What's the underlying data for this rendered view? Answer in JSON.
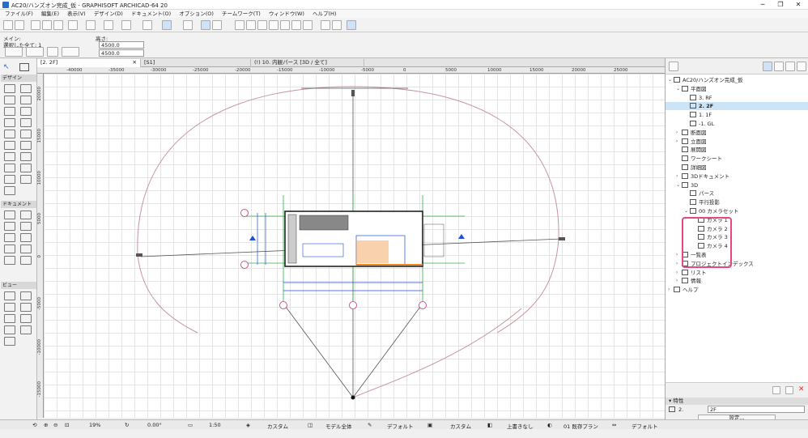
{
  "window": {
    "title": "AC20/ハンズオン完成_仮 - GRAPHISOFT ARCHICAD-64 20"
  },
  "menu": [
    "ファイル(F)",
    "編集(E)",
    "表示(V)",
    "デザイン(D)",
    "ドキュメント(O)",
    "オプション(O)",
    "チームワーク(T)",
    "ウィンドウ(W)",
    "ヘルプ(H)"
  ],
  "infobox": {
    "main_label": "メイン:",
    "selected_label": "選択した全て: 1",
    "height_label": "高さ:",
    "value1": "4500.0",
    "value2": "4500.0"
  },
  "toolbox": {
    "sections": [
      "デザイン",
      "ドキュメント",
      "ビュー"
    ]
  },
  "tabs": [
    "[2. 2F]",
    "[S1]",
    "(!) 10. 内観パース [3D / 全て]"
  ],
  "ruler": {
    "h": [
      "-40000",
      "-35000",
      "-30000",
      "-25000",
      "-20000",
      "-15000",
      "-10000",
      "-5000",
      "0",
      "5000",
      "10000",
      "15000",
      "20000",
      "25000"
    ],
    "v": [
      "20000",
      "15000",
      "10000",
      "5000",
      "0",
      "-5000",
      "-10000",
      "-15000"
    ]
  },
  "navigator": {
    "tree": [
      {
        "label": "AC20/ハンズオン完成_仮",
        "level": 0,
        "arrow": "v"
      },
      {
        "label": "平面図",
        "level": 1,
        "arrow": "v"
      },
      {
        "label": "3. RF",
        "level": 2,
        "arrow": ""
      },
      {
        "label": "2. 2F",
        "level": 2,
        "arrow": "",
        "selected": true
      },
      {
        "label": "1. 1F",
        "level": 2,
        "arrow": ""
      },
      {
        "label": "-1. GL",
        "level": 2,
        "arrow": ""
      },
      {
        "label": "断面図",
        "level": 1,
        "arrow": ">"
      },
      {
        "label": "立面図",
        "level": 1,
        "arrow": ">"
      },
      {
        "label": "展開図",
        "level": 1,
        "arrow": ""
      },
      {
        "label": "ワークシート",
        "level": 1,
        "arrow": ""
      },
      {
        "label": "詳細図",
        "level": 1,
        "arrow": ""
      },
      {
        "label": "3Dドキュメント",
        "level": 1,
        "arrow": ">"
      },
      {
        "label": "3D",
        "level": 1,
        "arrow": "v"
      },
      {
        "label": "パース",
        "level": 2,
        "arrow": ""
      },
      {
        "label": "平行投影",
        "level": 2,
        "arrow": ""
      },
      {
        "label": "00 カメラセット",
        "level": 2,
        "arrow": "v"
      },
      {
        "label": "カメラ 1",
        "level": 3,
        "arrow": ""
      },
      {
        "label": "カメラ 2",
        "level": 3,
        "arrow": ""
      },
      {
        "label": "カメラ 3",
        "level": 3,
        "arrow": ""
      },
      {
        "label": "カメラ 4",
        "level": 3,
        "arrow": ""
      },
      {
        "label": "一覧表",
        "level": 1,
        "arrow": ">"
      },
      {
        "label": "プロジェクトインデックス",
        "level": 1,
        "arrow": ">"
      },
      {
        "label": "リスト",
        "level": 1,
        "arrow": ">"
      },
      {
        "label": "情報",
        "level": 1,
        "arrow": ">"
      },
      {
        "label": "ヘルプ",
        "level": 0,
        "arrow": ">"
      }
    ]
  },
  "properties": {
    "header": "特性",
    "row_label": "2.",
    "row_value": "2F",
    "settings_button": "設定..."
  },
  "status": {
    "zoom": "19%",
    "angle": "0.00°",
    "scale": "1:50",
    "layer": "カスタム",
    "model": "モデル全体",
    "pen": "デフォルト",
    "display": "カスタム",
    "override": "上書きなし",
    "plan": "01 既存プラン",
    "dim": "デフォルト"
  },
  "colors": {
    "highlight": "#e8477a",
    "selected": "#cde4f7",
    "accent": "#1d6fd6"
  }
}
